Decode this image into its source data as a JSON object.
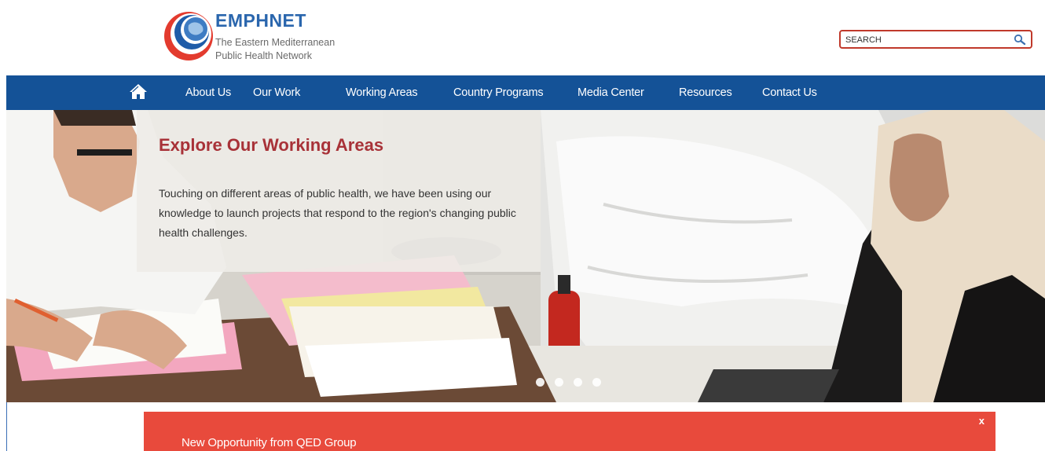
{
  "header": {
    "logo_title": "EMPHNET",
    "logo_subtitle_line1": "The Eastern Mediterranean",
    "logo_subtitle_line2": "Public Health Network"
  },
  "search": {
    "placeholder": "SEARCH",
    "value": ""
  },
  "nav": {
    "home_icon": "home-icon",
    "items": [
      {
        "label": "About Us"
      },
      {
        "label": "Our Work"
      },
      {
        "label": "Working Areas"
      },
      {
        "label": "Country Programs"
      },
      {
        "label": "Media Center"
      },
      {
        "label": "Resources"
      },
      {
        "label": "Contact Us"
      }
    ]
  },
  "hero": {
    "title": "Explore Our Working Areas",
    "text": "Touching on different areas of public health, we have been using our knowledge to launch projects that respond to the region's changing public health challenges.",
    "slide_count": 4
  },
  "notice": {
    "text": "New Opportunity from QED Group",
    "close_label": "x"
  },
  "colors": {
    "nav_bg": "#145297",
    "brand_blue": "#2a66ad",
    "hero_title": "#a83238",
    "notice_bg": "#e84a3c",
    "search_border": "#c0392b"
  }
}
